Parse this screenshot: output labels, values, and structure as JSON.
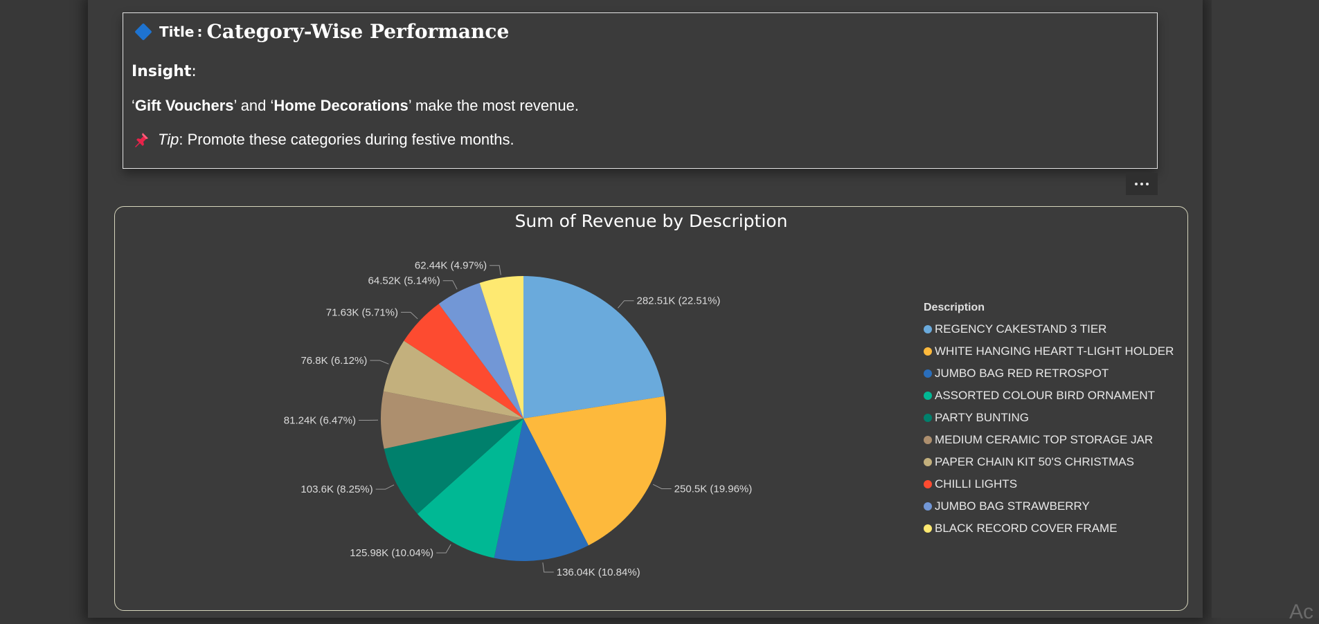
{
  "insight_card": {
    "title_label": "Title",
    "title_separator": ":",
    "title_text": "Category-Wise Performance",
    "insight_label": "Insight",
    "insight_colon": ":",
    "line_open_quote_1": "‘",
    "line_bold_1": "Gift Vouchers",
    "line_mid": "’ and ‘",
    "line_bold_2": "Home Decorations",
    "line_end": "’ make the most revenue.",
    "tip_label": "Tip",
    "tip_text": ": Promote these categories during festive months.",
    "diamond_icon": "blue-diamond-icon",
    "pin_icon": "red-pushpin-icon"
  },
  "more_options_icon": "ellipsis-icon",
  "corner_text": "Ac",
  "chart_data": {
    "type": "pie",
    "title": "Sum of Revenue by Description",
    "legend_title": "Description",
    "legend_position": "right",
    "slices": [
      {
        "name": "REGENCY CAKESTAND 3 TIER",
        "value": 282510,
        "label": "282.51K (22.51%)",
        "color": "#6aaadc"
      },
      {
        "name": "WHITE HANGING HEART T-LIGHT HOLDER",
        "value": 250500,
        "label": "250.5K (19.96%)",
        "color": "#fdb93c"
      },
      {
        "name": "JUMBO BAG RED RETROSPOT",
        "value": 136040,
        "label": "136.04K (10.84%)",
        "color": "#2a6ebb"
      },
      {
        "name": "ASSORTED COLOUR BIRD ORNAMENT",
        "value": 125980,
        "label": "125.98K (10.04%)",
        "color": "#00b894"
      },
      {
        "name": "PARTY BUNTING",
        "value": 103600,
        "label": "103.6K (8.25%)",
        "color": "#00806c"
      },
      {
        "name": "MEDIUM CERAMIC TOP STORAGE JAR",
        "value": 81240,
        "label": "81.24K (6.47%)",
        "color": "#ad8f6e"
      },
      {
        "name": "PAPER CHAIN KIT 50'S CHRISTMAS",
        "value": 76800,
        "label": "76.8K (6.12%)",
        "color": "#c3b07d"
      },
      {
        "name": "CHILLI LIGHTS",
        "value": 71630,
        "label": "71.63K (5.71%)",
        "color": "#fd4b30"
      },
      {
        "name": "JUMBO BAG STRAWBERRY",
        "value": 64520,
        "label": "64.52K (5.14%)",
        "color": "#7297d6"
      },
      {
        "name": "BLACK RECORD COVER FRAME",
        "value": 62440,
        "label": "62.44K (4.97%)",
        "color": "#fee971"
      }
    ]
  }
}
